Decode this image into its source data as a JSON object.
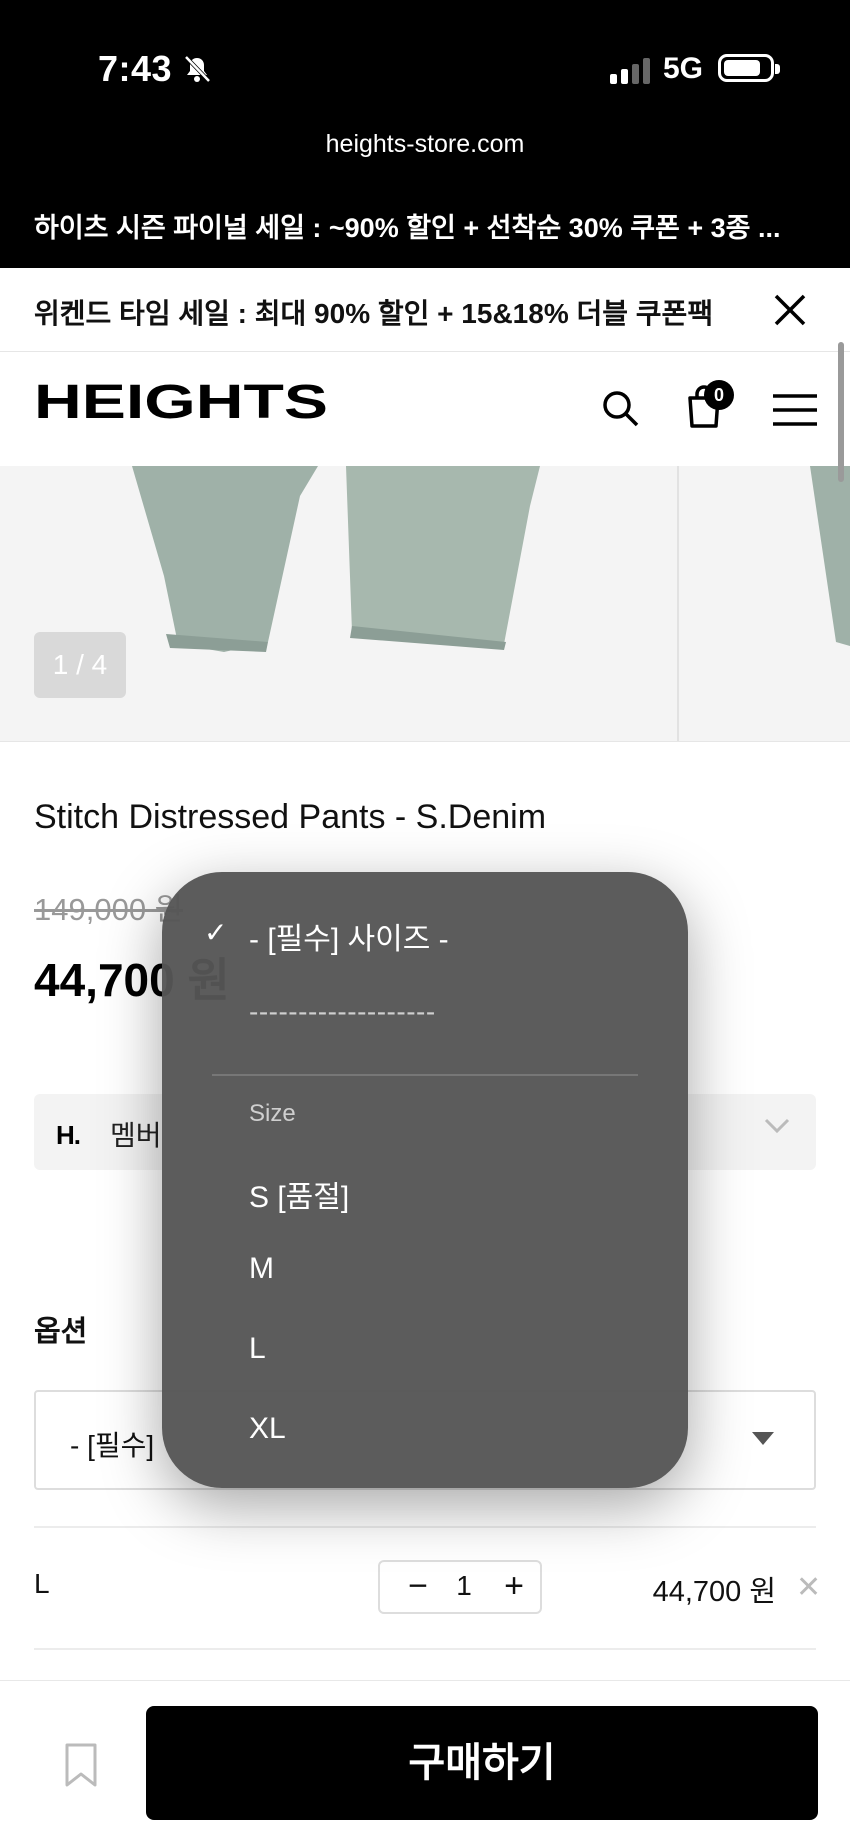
{
  "status_bar": {
    "time": "7:43",
    "network": "5G"
  },
  "browser": {
    "url": "heights-store.com"
  },
  "promo_banner": {
    "text": "하이츠 시즌 파이널 세일 : ~90% 할인 + 선착순 30% 쿠폰 + 3종 ..."
  },
  "notice_bar": {
    "text": "위켄드 타임 세일 : 최대 90% 할인 + 15&18% 더블 쿠폰팩"
  },
  "header": {
    "logo": "HEIGHTS",
    "cart_count": "0"
  },
  "gallery": {
    "counter": "1 / 4"
  },
  "product": {
    "title": "Stitch Distressed Pants - S.Denim",
    "original_price": "149,000 원",
    "sale_price": "44,700 원"
  },
  "member": {
    "logo": "H.",
    "text": "멤버"
  },
  "options": {
    "label": "옵션",
    "select_value": "- [필수]"
  },
  "selected_line": {
    "size": "L",
    "quantity": "1",
    "price": "44,700 원"
  },
  "bottom_bar": {
    "buy_label": "구매하기"
  },
  "size_menu": {
    "selected": "- [필수] 사이즈 -",
    "dashes": "-------------------",
    "group_header": "Size",
    "items": [
      "S [품절]",
      "M",
      "L",
      "XL"
    ]
  }
}
